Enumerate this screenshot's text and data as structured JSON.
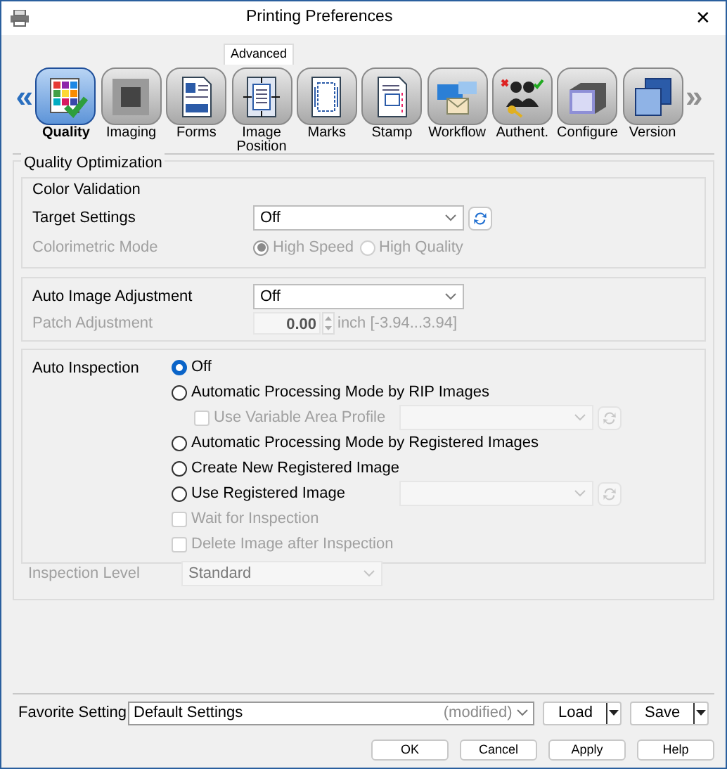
{
  "window": {
    "title": "Printing Preferences",
    "close": "✕"
  },
  "tabs": [
    {
      "label": "Advanced",
      "selected": true
    }
  ],
  "toolbar": {
    "prev": {
      "label": "«",
      "disabled": false
    },
    "next": {
      "label": "»",
      "disabled": true
    },
    "items": [
      {
        "label": "Quality",
        "selected": true
      },
      {
        "label": "Imaging",
        "selected": false
      },
      {
        "label": "Forms",
        "selected": false
      },
      {
        "label": "Image Position",
        "selected": false
      },
      {
        "label": "Marks",
        "selected": false
      },
      {
        "label": "Stamp",
        "selected": false
      },
      {
        "label": "Workflow",
        "selected": false
      },
      {
        "label": "Authent.",
        "selected": false
      },
      {
        "label": "Configure",
        "selected": false
      },
      {
        "label": "Version",
        "selected": false
      }
    ]
  },
  "quality_optimization": {
    "title": "Quality Optimization",
    "color_validation": {
      "title": "Color Validation",
      "target_settings": {
        "label": "Target Settings",
        "value": "Off",
        "disabled": false
      },
      "colorimetric_mode": {
        "label": "Colorimetric Mode",
        "disabled": true,
        "options": [
          {
            "label": "High Speed",
            "selected": true
          },
          {
            "label": "High Quality",
            "selected": false
          }
        ]
      }
    },
    "auto_image_adjustment": {
      "label": "Auto Image Adjustment",
      "value": "Off",
      "disabled": false
    },
    "patch_adjustment": {
      "label": "Patch Adjustment",
      "value": "0.00",
      "unit": "inch [-3.94...3.94]",
      "disabled": true
    },
    "auto_inspection": {
      "label": "Auto Inspection",
      "options": [
        {
          "kind": "radio",
          "label": "Off",
          "selected": true,
          "disabled": false
        },
        {
          "kind": "radio",
          "label": "Automatic Processing Mode by RIP Images",
          "selected": false,
          "disabled": false,
          "children": [
            {
              "kind": "checkbox",
              "label": "Use Variable Area Profile",
              "checked": false,
              "disabled": true,
              "dropdown": {
                "disabled": true
              }
            }
          ]
        },
        {
          "kind": "radio",
          "label": "Automatic Processing Mode by Registered Images",
          "selected": false,
          "disabled": false
        },
        {
          "kind": "radio",
          "label": "Create New Registered Image",
          "selected": false,
          "disabled": false
        },
        {
          "kind": "radio",
          "label": "Use Registered Image",
          "selected": false,
          "disabled": false,
          "dropdown": {
            "disabled": true
          }
        },
        {
          "kind": "checkbox",
          "label": "Wait for Inspection",
          "checked": false,
          "disabled": true
        },
        {
          "kind": "checkbox",
          "label": "Delete Image after Inspection",
          "checked": false,
          "disabled": true
        }
      ]
    },
    "inspection_level": {
      "label": "Inspection Level",
      "value": "Standard",
      "disabled": true
    }
  },
  "favorite": {
    "label": "Favorite Setting",
    "value": "Default Settings",
    "note": "(modified)",
    "load": "Load",
    "save": "Save"
  },
  "buttons": [
    "OK",
    "Cancel",
    "Apply",
    "Help"
  ]
}
